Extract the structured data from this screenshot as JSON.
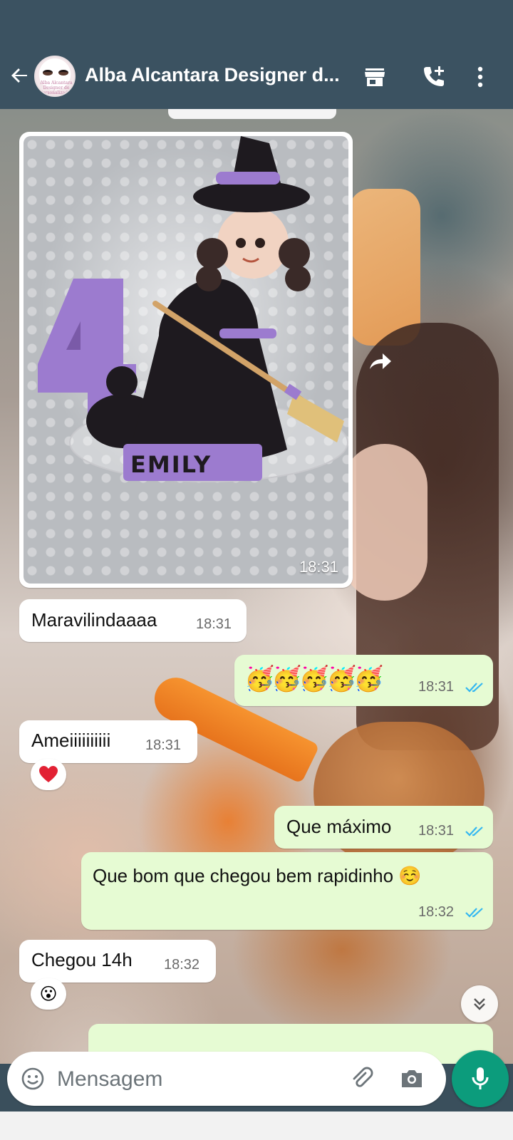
{
  "header": {
    "title": "Alba Alcantara Designer d...",
    "avatar_brand": "Alba Alcantara Designer de Personalizados"
  },
  "colors": {
    "app_bar": "#3b5261",
    "incoming_bubble": "#ffffff",
    "outgoing_bubble": "#e6fbd3",
    "read_ticks": "#34b7f1",
    "mic_button": "#0c9c7c"
  },
  "messages": [
    {
      "type": "image",
      "direction": "incoming",
      "caption_on_image": "EMILY",
      "time": "18:31"
    },
    {
      "type": "text",
      "direction": "incoming",
      "text": "Maravilindaaaa",
      "time": "18:31"
    },
    {
      "type": "text",
      "direction": "outgoing",
      "text": "🥳🥳🥳🥳🥳",
      "time": "18:31",
      "status": "read"
    },
    {
      "type": "text",
      "direction": "incoming",
      "text": "Ameiiiiiiiiii",
      "time": "18:31",
      "reaction": "❤️"
    },
    {
      "type": "text",
      "direction": "outgoing",
      "text": "Que máximo",
      "time": "18:31",
      "status": "read"
    },
    {
      "type": "text",
      "direction": "outgoing",
      "text": "Que bom que chegou bem rapidinho ☺️",
      "time": "18:32",
      "status": "read"
    },
    {
      "type": "text",
      "direction": "incoming",
      "text": "Chegou 14h",
      "time": "18:32",
      "reaction": "😮"
    }
  ],
  "composer": {
    "placeholder": "Mensagem"
  },
  "icons": [
    "back-arrow-icon",
    "store-icon",
    "add-call-icon",
    "more-vert-icon",
    "forward-icon",
    "emoji-icon",
    "attach-icon",
    "camera-icon",
    "mic-icon",
    "chevron-double-down-icon",
    "heart-icon"
  ]
}
